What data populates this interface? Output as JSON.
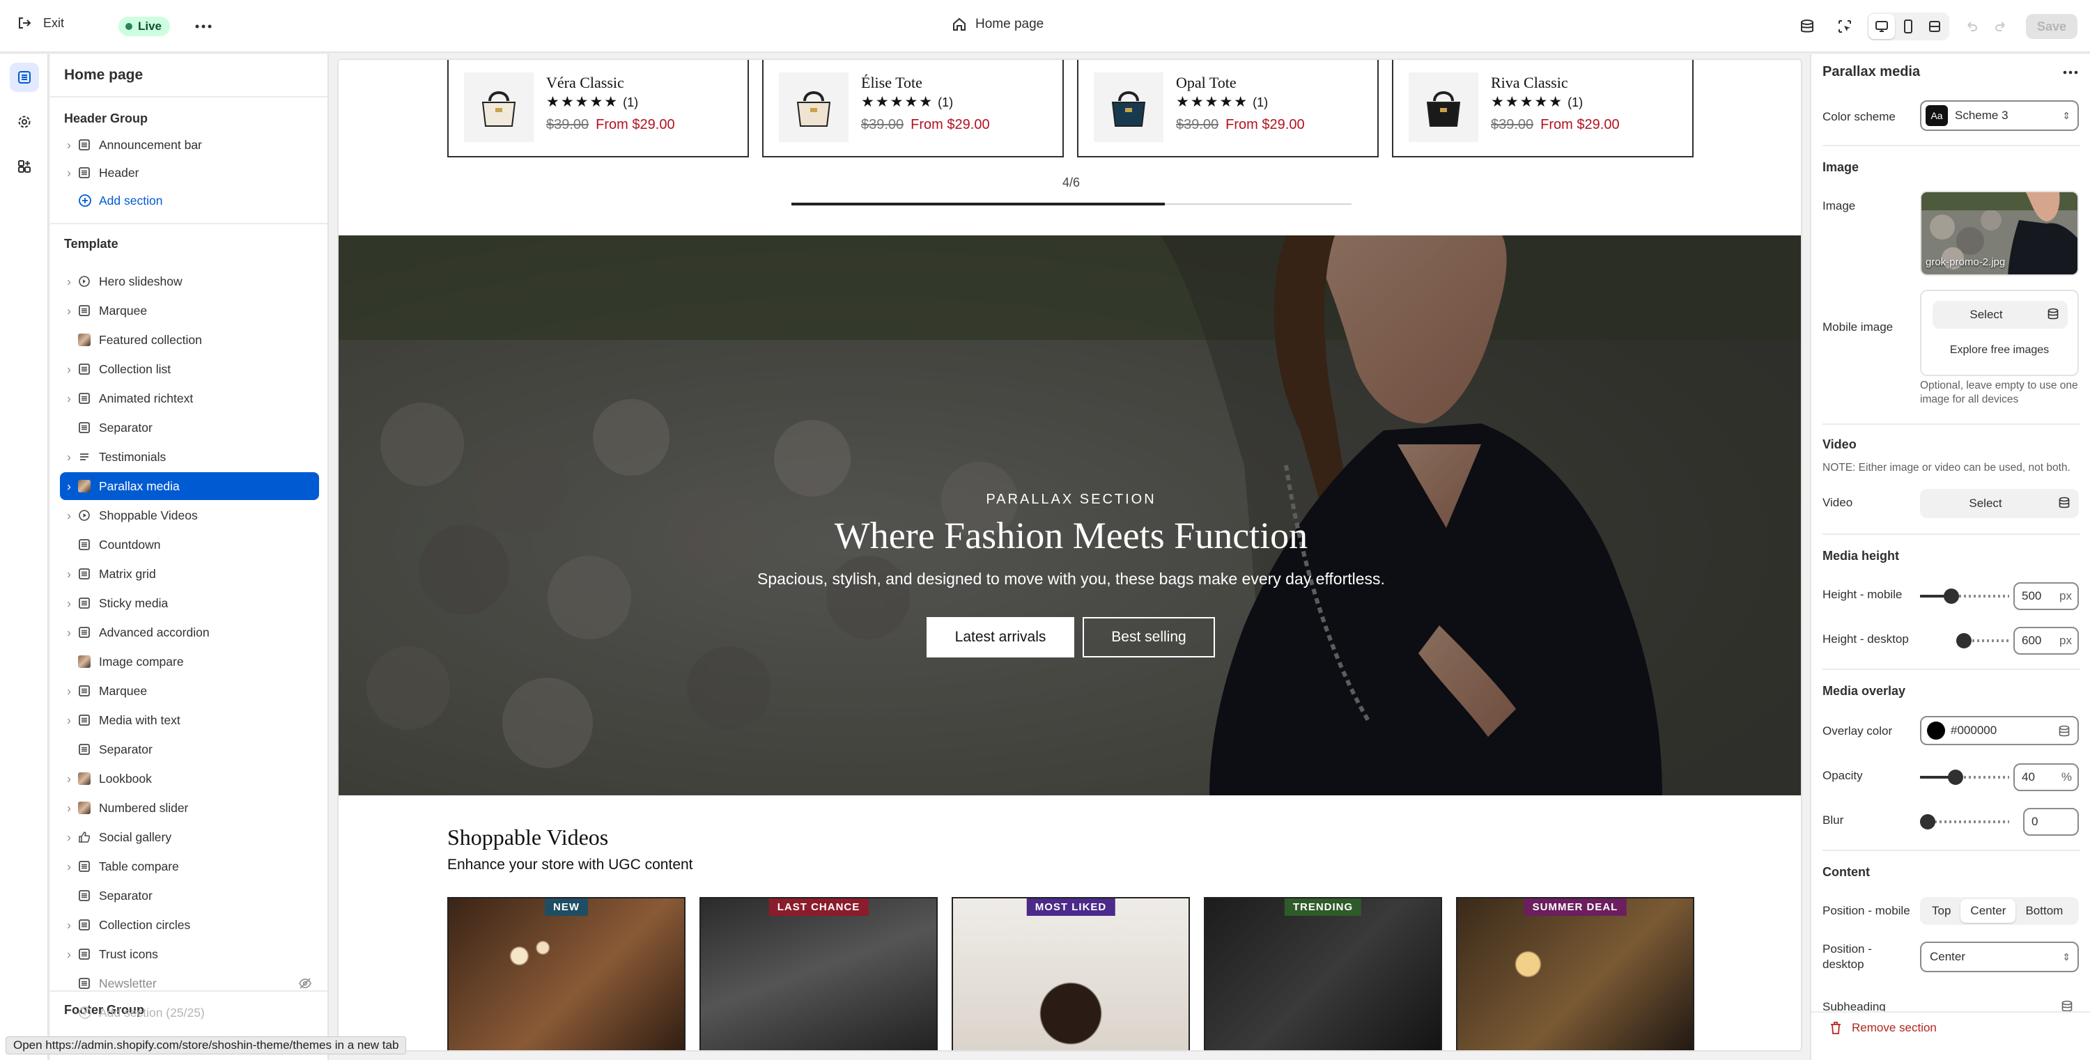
{
  "topbar": {
    "exit_label": "Exit",
    "live_label": "Live",
    "page_title": "Home page",
    "save_label": "Save"
  },
  "sidebar": {
    "title": "Home page",
    "header_group": {
      "title": "Header Group",
      "items": [
        "Announcement bar",
        "Header"
      ],
      "add_label": "Add section"
    },
    "template": {
      "title": "Template",
      "items": [
        "Hero slideshow",
        "Marquee",
        "Featured collection",
        "Collection list",
        "Animated richtext",
        "Separator",
        "Testimonials",
        "Parallax media",
        "Shoppable Videos",
        "Countdown",
        "Matrix grid",
        "Sticky media",
        "Advanced accordion",
        "Image compare",
        "Marquee",
        "Media with text",
        "Separator",
        "Lookbook",
        "Numbered slider",
        "Social gallery",
        "Table compare",
        "Separator",
        "Collection circles",
        "Trust icons",
        "Newsletter"
      ],
      "add_label": "Add section (25/25)"
    },
    "footer_group": {
      "title": "Footer Group"
    }
  },
  "canvas": {
    "products": [
      {
        "name": "Véra Classic",
        "stars": "★★★★★",
        "count": "(1)",
        "old_price": "$39.00",
        "new_price": "From $29.00"
      },
      {
        "name": "Élise Tote",
        "stars": "★★★★★",
        "count": "(1)",
        "old_price": "$39.00",
        "new_price": "From $29.00"
      },
      {
        "name": "Opal Tote",
        "stars": "★★★★★",
        "count": "(1)",
        "old_price": "$39.00",
        "new_price": "From $29.00"
      },
      {
        "name": "Riva Classic",
        "stars": "★★★★★",
        "count": "(1)",
        "old_price": "$39.00",
        "new_price": "From $29.00"
      }
    ],
    "pager": {
      "text": "4/6",
      "progress": 0.667
    },
    "hero": {
      "eyebrow": "PARALLAX SECTION",
      "title": "Where Fashion Meets Function",
      "subtitle": "Spacious, stylish, and designed to move with you, these bags make every day effortless.",
      "primary_button": "Latest arrivals",
      "secondary_button": "Best selling"
    },
    "shoppable": {
      "title": "Shoppable Videos",
      "subtitle": "Enhance your store with UGC content",
      "videos": [
        {
          "badge": "NEW",
          "badge_color": "#1f4e63"
        },
        {
          "badge": "LAST CHANCE",
          "badge_color": "#8a1c2b"
        },
        {
          "badge": "MOST LIKED",
          "badge_color": "#4b2a8a"
        },
        {
          "badge": "TRENDING",
          "badge_color": "#2f5a2a"
        },
        {
          "badge": "SUMMER DEAL",
          "badge_color": "#6b1f5e"
        }
      ]
    }
  },
  "status_url": "Open https://admin.shopify.com/store/shoshin-theme/themes in a new tab",
  "settings": {
    "title": "Parallax media",
    "color_scheme_label": "Color scheme",
    "color_scheme_value": "Scheme 3",
    "color_scheme_swatch": "Aa",
    "image_section": "Image",
    "image_label": "Image",
    "image_filename": "grok-promo-2.jpg",
    "mobile_image_label": "Mobile image",
    "select_label": "Select",
    "explore_label": "Explore free images",
    "mobile_note": "Optional, leave empty to use one image for all devices",
    "video_section": "Video",
    "video_note": "NOTE: Either image or video can be used, not both.",
    "video_label": "Video",
    "video_select": "Select",
    "media_height_section": "Media height",
    "height_mobile_label": "Height - mobile",
    "height_mobile_value": "500",
    "height_desktop_label": "Height - desktop",
    "height_desktop_value": "600",
    "px_unit": "px",
    "overlay_section": "Media overlay",
    "overlay_color_label": "Overlay color",
    "overlay_color_value": "#000000",
    "opacity_label": "Opacity",
    "opacity_value": "40",
    "percent_unit": "%",
    "blur_label": "Blur",
    "blur_value": "0",
    "content_section": "Content",
    "position_mobile_label": "Position - mobile",
    "position_options": [
      "Top",
      "Center",
      "Bottom"
    ],
    "position_mobile_selected": "Center",
    "position_desktop_label": "Position - desktop",
    "position_desktop_value": "Center",
    "subheading_label": "Subheading",
    "remove_label": "Remove section"
  },
  "colors": {
    "accent": "#005bd3",
    "live_bg": "#cdfee1",
    "sale_red": "#b3121f",
    "remove_red": "#b3261e"
  }
}
